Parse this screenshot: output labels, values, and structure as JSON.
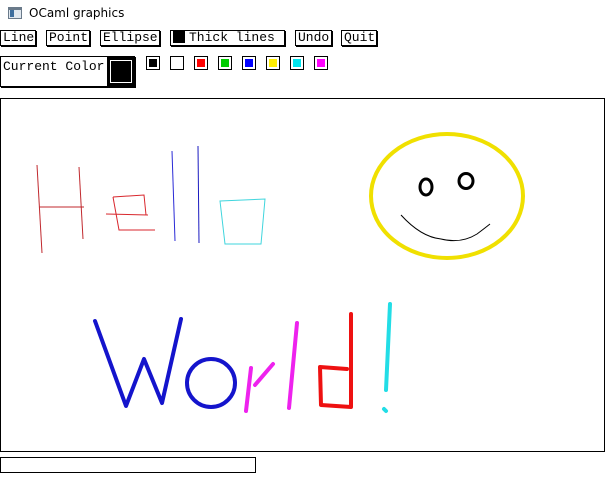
{
  "window": {
    "title": "OCaml graphics",
    "icon": "window-app-icon"
  },
  "toolbar": {
    "line_label": "Line",
    "point_label": "Point",
    "ellipse_label": "Ellipse",
    "thick_lines_label": "Thick lines",
    "thick_lines_swatch_color": "#000000",
    "undo_label": "Undo",
    "quit_label": "Quit"
  },
  "current_color": {
    "label": "Current Color",
    "value": "#000000"
  },
  "palette": [
    {
      "name": "black",
      "color": "#000000"
    },
    {
      "name": "white",
      "color": "#ffffff"
    },
    {
      "name": "red",
      "color": "#ff0000"
    },
    {
      "name": "green",
      "color": "#00cc00"
    },
    {
      "name": "blue",
      "color": "#0000ff"
    },
    {
      "name": "yellow",
      "color": "#ffee00"
    },
    {
      "name": "cyan",
      "color": "#00e5ee"
    },
    {
      "name": "magenta",
      "color": "#ff00ff"
    }
  ],
  "status": {
    "value": ""
  }
}
